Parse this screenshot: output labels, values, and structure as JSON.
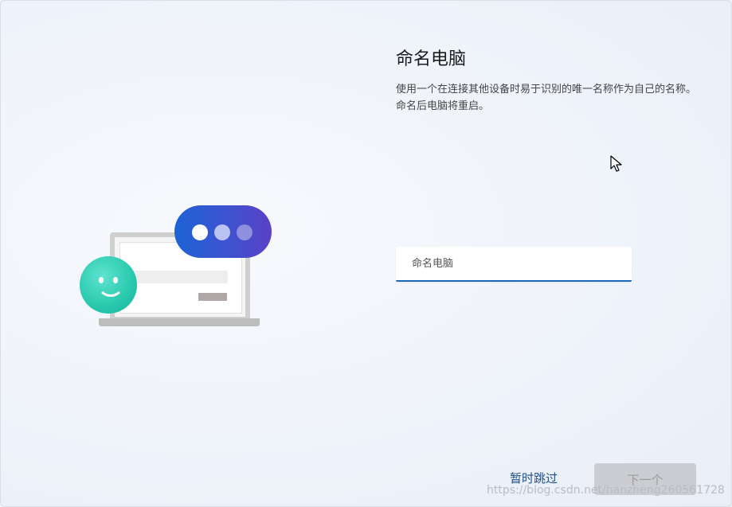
{
  "page": {
    "title": "命名电脑",
    "description": "使用一个在连接其他设备时易于识别的唯一名称作为自己的名称。命名后电脑将重启。"
  },
  "name_input": {
    "placeholder": "命名电脑",
    "value": ""
  },
  "buttons": {
    "skip_label": "暂时跳过",
    "next_label": "下一个"
  },
  "watermark": "https://blog.csdn.net/hanzheng260561728",
  "colors": {
    "accent": "#1b66b8",
    "skip_text": "#1e4f8a",
    "next_disabled_bg": "#cbcdd2",
    "bubble": "#3e53cf",
    "smiley": "#2ccbb0"
  },
  "icons": [
    "pointer-cursor-icon",
    "laptop-illustration",
    "chat-bubble-icon",
    "smiley-face-icon"
  ]
}
